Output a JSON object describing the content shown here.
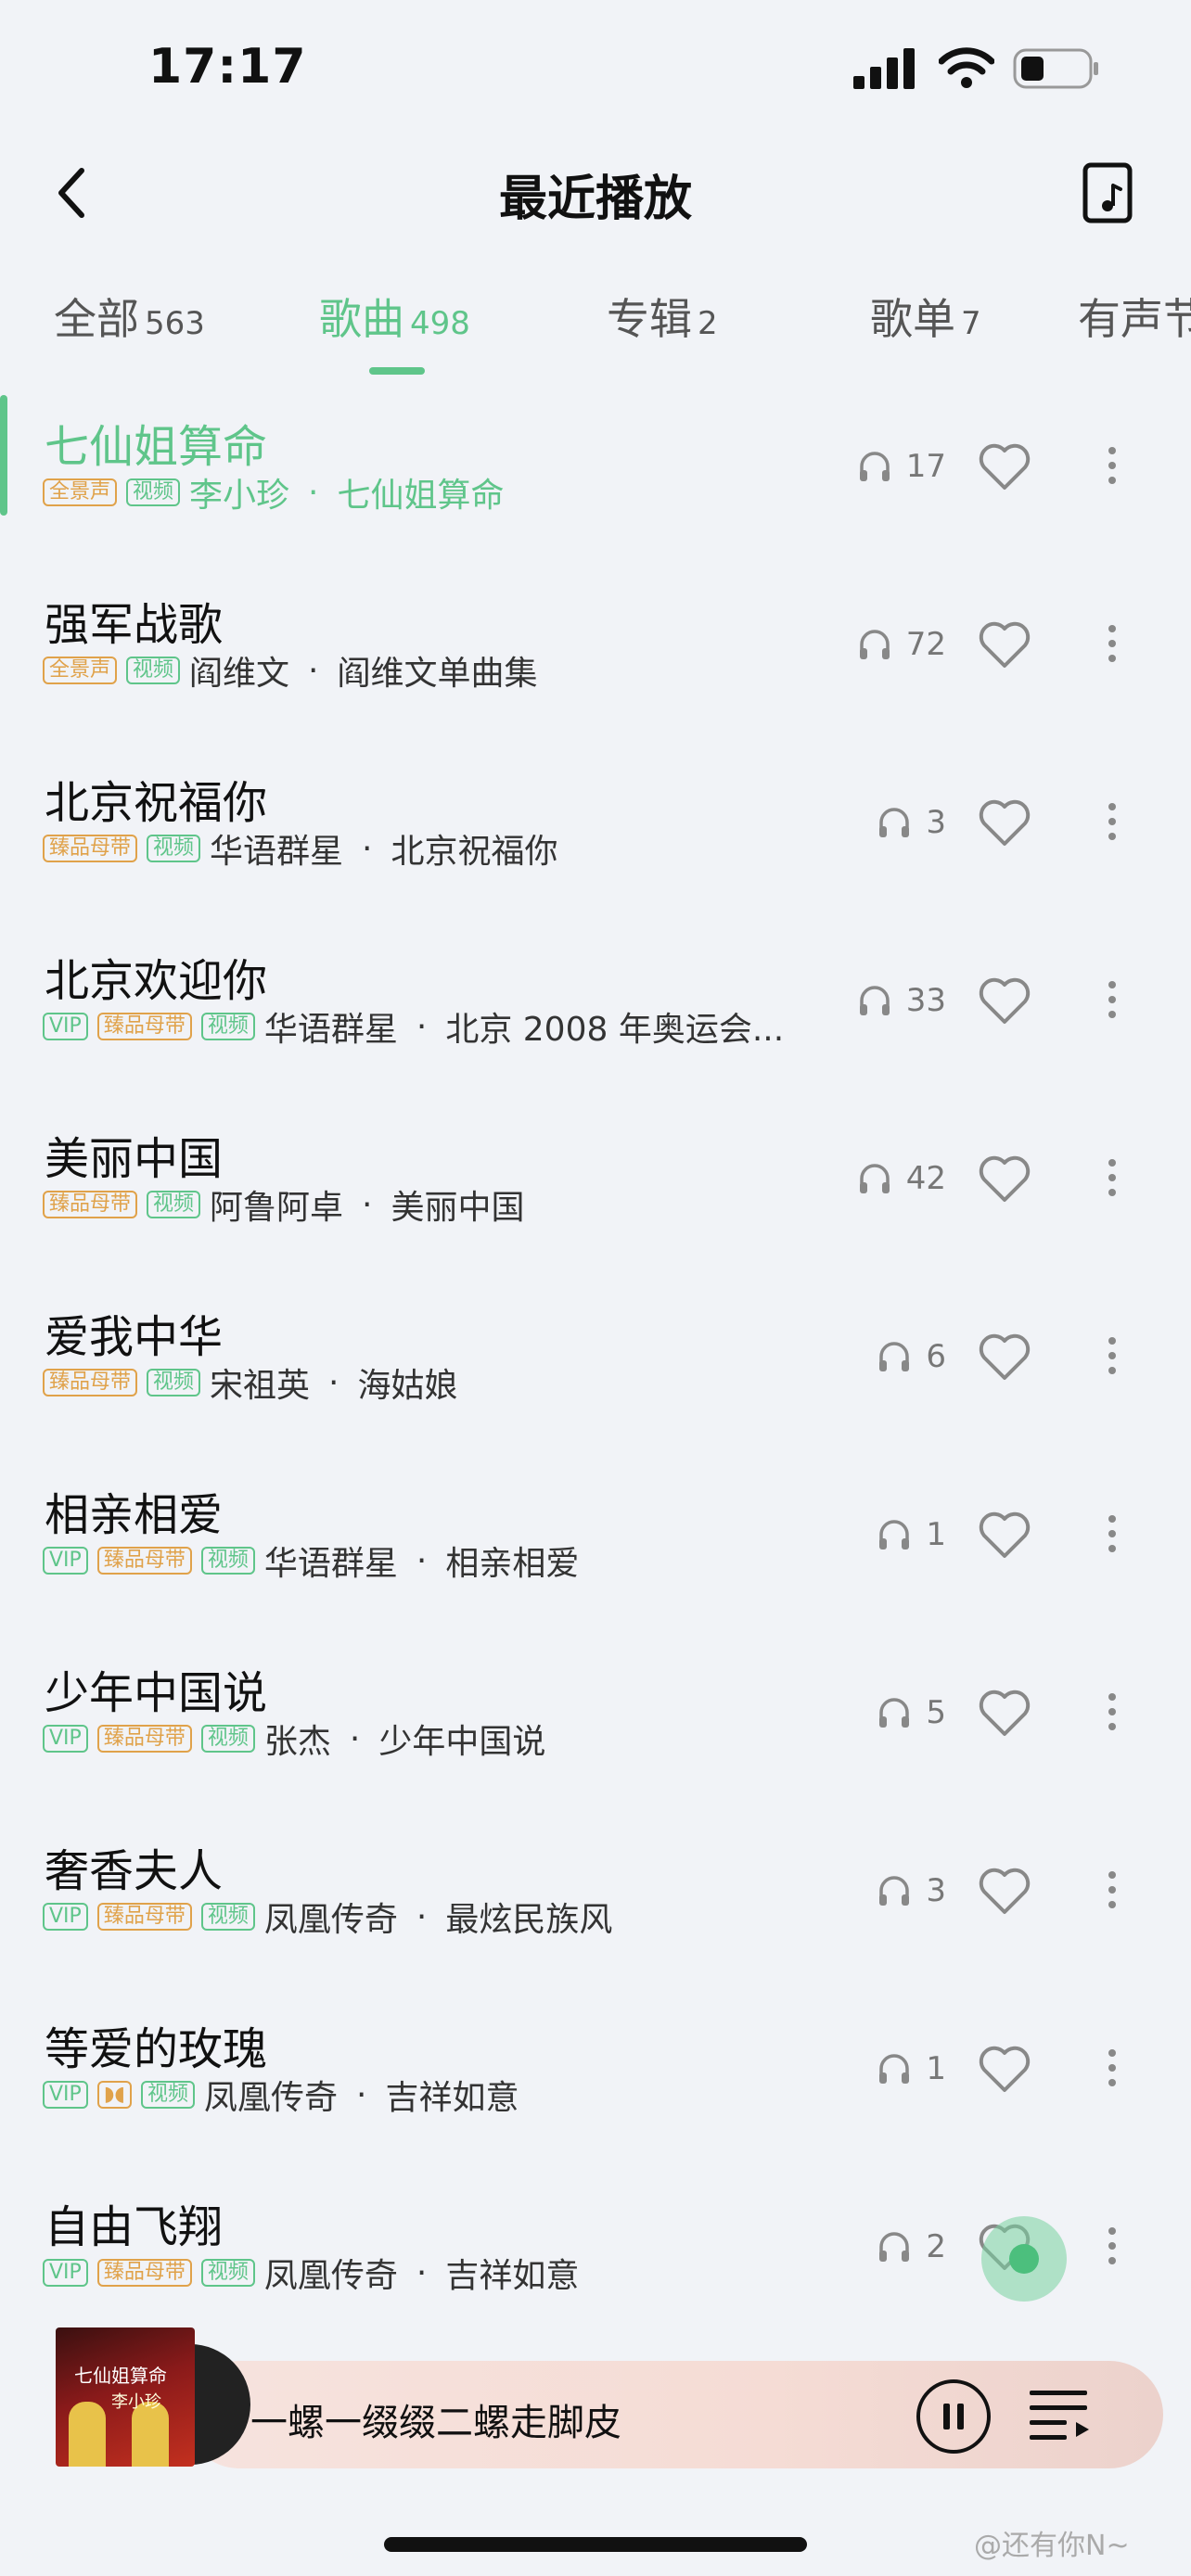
{
  "status_bar": {
    "time": "17:17"
  },
  "header": {
    "title": "最近播放"
  },
  "tabs": [
    {
      "label": "全部",
      "count": "563"
    },
    {
      "label": "歌曲",
      "count": "498"
    },
    {
      "label": "专辑",
      "count": "2"
    },
    {
      "label": "歌单",
      "count": "7"
    },
    {
      "label": "有声节",
      "count": ""
    }
  ],
  "badges": {
    "quanjingsheng": "全景声",
    "video": "视频",
    "zhenpin": "臻品母带",
    "vip": "VIP"
  },
  "songs": [
    {
      "title": "七仙姐算命",
      "artist": "李小珍",
      "album": "七仙姐算命",
      "plays": "17"
    },
    {
      "title": "强军战歌",
      "artist": "阎维文",
      "album": "阎维文单曲集",
      "plays": "72"
    },
    {
      "title": "北京祝福你",
      "artist": "华语群星",
      "album": "北京祝福你",
      "plays": "3"
    },
    {
      "title": "北京欢迎你",
      "artist": "华语群星",
      "album": "北京 2008 年奥运会...",
      "plays": "33"
    },
    {
      "title": "美丽中国",
      "artist": "阿鲁阿卓",
      "album": "美丽中国",
      "plays": "42"
    },
    {
      "title": "爱我中华",
      "artist": "宋祖英",
      "album": "海姑娘",
      "plays": "6"
    },
    {
      "title": "相亲相爱",
      "artist": "华语群星",
      "album": "相亲相爱",
      "plays": "1"
    },
    {
      "title": "少年中国说",
      "artist": "张杰",
      "album": "少年中国说",
      "plays": "5"
    },
    {
      "title": "奢香夫人",
      "artist": "凤凰传奇",
      "album": "最炫民族风",
      "plays": "3"
    },
    {
      "title": "等爱的玫瑰",
      "artist": "凤凰传奇",
      "album": "吉祥如意",
      "plays": "1"
    },
    {
      "title": "自由飞翔",
      "artist": "凤凰传奇",
      "album": "吉祥如意",
      "plays": "2"
    }
  ],
  "separator": "·",
  "player": {
    "now_playing": "一螺一缀缀二螺走脚皮",
    "cover_title": "七仙姐算命",
    "cover_artist": "李小珍"
  },
  "watermark": "@还有你N~",
  "colors": {
    "accent": "#5fc58a",
    "badge_orange": "#e0a24a",
    "background": "#f1f3f7"
  }
}
